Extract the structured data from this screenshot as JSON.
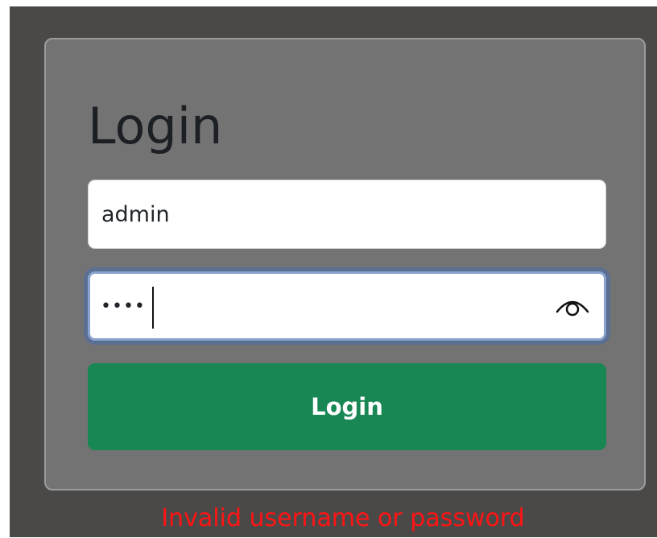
{
  "login_form": {
    "title": "Login",
    "username_value": "admin",
    "password_value": "••••",
    "password_toggle_icon": "eye-icon",
    "submit_label": "Login"
  },
  "error": {
    "message": "Invalid username or password"
  },
  "colors": {
    "backdrop": "#4b4948",
    "card": "#737373",
    "button": "#198754",
    "error": "#ff1414",
    "focus_ring": "#8aa3cf"
  }
}
